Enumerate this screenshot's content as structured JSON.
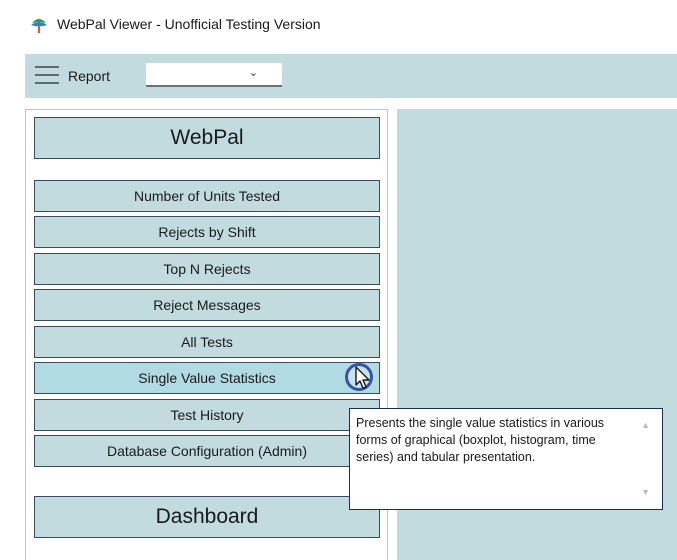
{
  "window": {
    "title": "WebPal Viewer - Unofficial Testing Version"
  },
  "toolbar": {
    "report_label": "Report",
    "report_value": "",
    "report_chevron": "⌄"
  },
  "sidebar": {
    "header": "WebPal",
    "items": [
      {
        "label": "Number of Units Tested"
      },
      {
        "label": "Rejects by Shift"
      },
      {
        "label": "Top N Rejects"
      },
      {
        "label": "Reject Messages"
      },
      {
        "label": "All Tests"
      },
      {
        "label": "Single Value Statistics"
      },
      {
        "label": "Test History"
      },
      {
        "label": "Database Configuration (Admin)"
      }
    ],
    "footer": "Dashboard"
  },
  "tooltip": {
    "text": "Presents the single value statistics in various forms of graphical (boxplot, histogram, time series) and tabular presentation.",
    "scroll_up": "▲",
    "scroll_down": "▼"
  },
  "colors": {
    "panel_bg": "#c2dbdf",
    "button_border": "#3a4a63",
    "hover_bg": "#b0dbe3",
    "tooltip_border": "#1c2e57",
    "cursor_ring": "#3753a4"
  }
}
